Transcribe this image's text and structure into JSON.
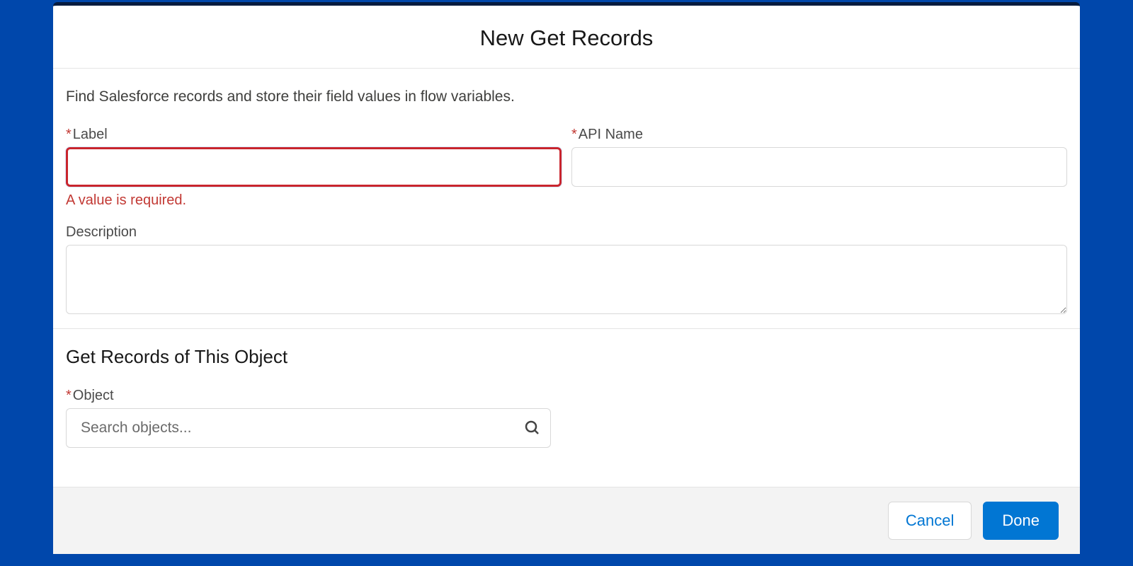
{
  "modal": {
    "title": "New Get Records",
    "intro": "Find Salesforce records and store their field values in flow variables."
  },
  "form": {
    "label": {
      "label": "Label",
      "value": "",
      "error": "A value is required."
    },
    "apiName": {
      "label": "API Name",
      "value": ""
    },
    "description": {
      "label": "Description",
      "value": ""
    }
  },
  "section": {
    "title": "Get Records of This Object",
    "object": {
      "label": "Object",
      "placeholder": "Search objects...",
      "value": ""
    }
  },
  "footer": {
    "cancel": "Cancel",
    "done": "Done"
  },
  "required": "*"
}
